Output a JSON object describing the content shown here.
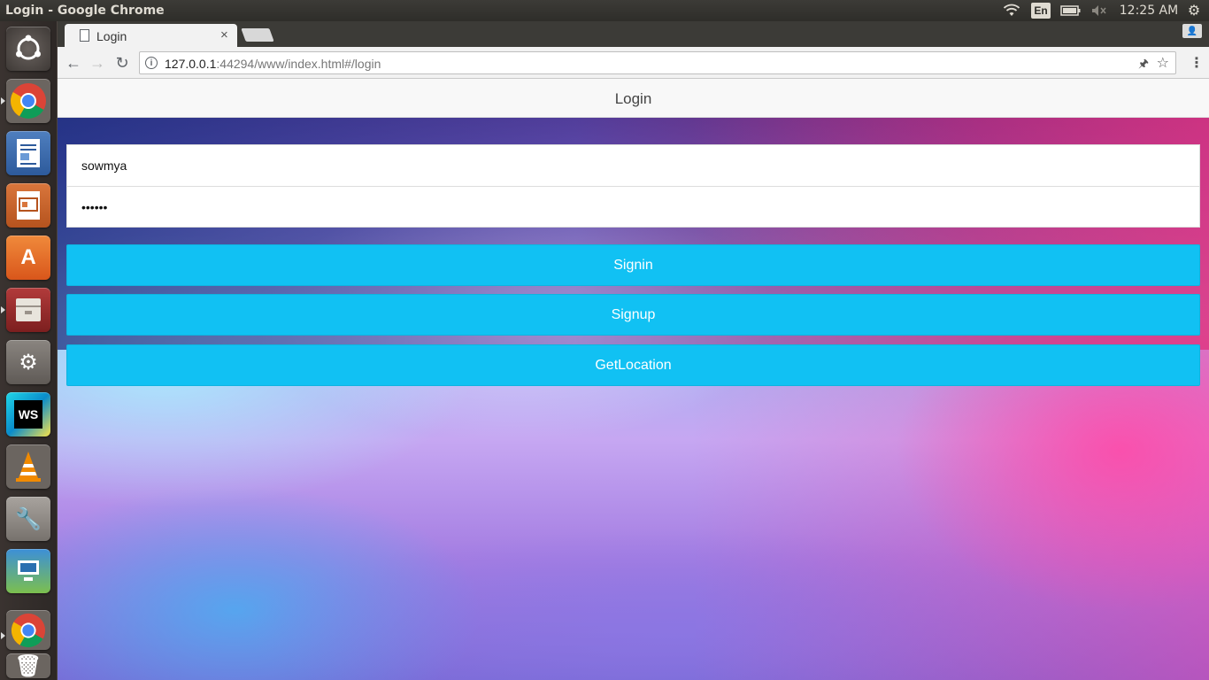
{
  "os_panel": {
    "window_title": "Login - Google Chrome",
    "lang": "En",
    "clock": "12:25 AM",
    "icons": [
      "wifi-icon",
      "keyboard-lang-indicator",
      "battery-icon",
      "volume-muted-icon",
      "power-gear-icon"
    ]
  },
  "launcher": {
    "items": [
      {
        "name": "ubuntu-dash",
        "icon": "ubuntu-logo-icon"
      },
      {
        "name": "google-chrome",
        "icon": "chrome-icon"
      },
      {
        "name": "libreoffice-writer",
        "icon": "writer-icon"
      },
      {
        "name": "libreoffice-impress",
        "icon": "impress-icon"
      },
      {
        "name": "ubuntu-software",
        "icon": "software-center-icon"
      },
      {
        "name": "file-archiver",
        "icon": "archive-icon"
      },
      {
        "name": "system-settings",
        "icon": "settings-tools-icon"
      },
      {
        "name": "webstorm",
        "icon": "webstorm-icon",
        "label": "WS"
      },
      {
        "name": "vlc",
        "icon": "vlc-cone-icon"
      },
      {
        "name": "wine-tools",
        "icon": "wine-icon"
      },
      {
        "name": "screenshot-app",
        "icon": "screenshot-icon"
      },
      {
        "name": "google-chrome-2",
        "icon": "chrome-icon"
      },
      {
        "name": "trash",
        "icon": "trash-icon"
      }
    ]
  },
  "browser": {
    "tab_title": "Login",
    "tab_close": "×",
    "url_host": "127.0.0.1",
    "url_rest": ":44294/www/index.html#/login"
  },
  "page": {
    "title": "Login",
    "username_value": "sowmya",
    "password_value": "••••••",
    "signin_label": "Signin",
    "signup_label": "Signup",
    "getlocation_label": "GetLocation"
  },
  "colors": {
    "button": "#11c1f3",
    "navbar": "#f8f8f8"
  }
}
